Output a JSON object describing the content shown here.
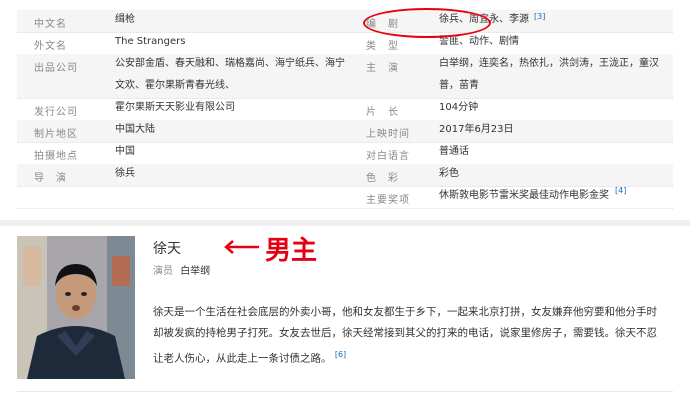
{
  "info": {
    "left": [
      {
        "label": "中文名",
        "value": "缉枪"
      },
      {
        "label": "外文名",
        "value": "The Strangers"
      },
      {
        "label": "出品公司",
        "value_line1": "公安部金盾、春天融和、瑞格嘉尚、海宁纸兵、海宁",
        "value_line2": "文欢、霍尔果斯青春光线、"
      },
      {
        "label": "发行公司",
        "value": "霍尔果斯天天影业有限公司"
      },
      {
        "label": "制片地区",
        "value": "中国大陆"
      },
      {
        "label": "拍摄地点",
        "value": "中国"
      },
      {
        "label": "导　演",
        "value": "徐兵"
      }
    ],
    "right": [
      {
        "label": "编　剧",
        "value": "徐兵、周宜永、李源",
        "sup": "[3]"
      },
      {
        "label": "类　型",
        "value": "警匪、动作、剧情"
      },
      {
        "label": "主　演",
        "value_line1": "白举纲，连奕名，热依扎，洪剑涛，王泷正，童汉",
        "value_line2": "普，苗青"
      },
      {
        "label": "片　长",
        "value": "104分钟"
      },
      {
        "label": "上映时间",
        "value": "2017年6月23日"
      },
      {
        "label": "对白语言",
        "value": "普通话"
      },
      {
        "label": "色　彩",
        "value": "彩色"
      },
      {
        "label": "主要奖项",
        "value": "休斯敦电影节雷米奖最佳动作电影金奖",
        "sup": "[4]"
      }
    ]
  },
  "actor": {
    "name": "徐天",
    "actor_label": "演员",
    "actor_name": "白举纲",
    "annotation": "男主",
    "description": "徐天是一个生活在社会底层的外卖小哥，他和女友都生于乡下，一起来北京打拼，女友嫌弃他穷要和他分手时却被发疯的持枪男子打死。女友去世后，徐天经常接到其父的打来的电话，说家里修房子，需要钱。徐天不忍让老人伤心，从此走上一条讨债之路。",
    "desc_sup": "[6]"
  },
  "colors": {
    "accent": "#e60012",
    "link": "#136ec2"
  }
}
